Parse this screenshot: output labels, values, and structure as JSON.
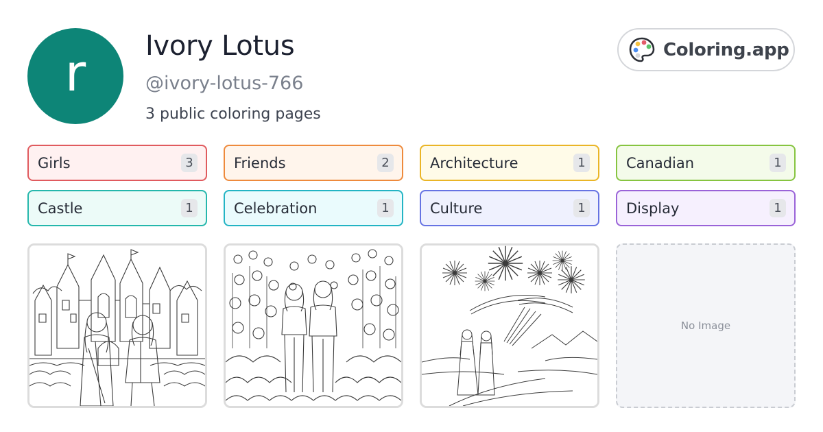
{
  "profile": {
    "avatar_letter": "r",
    "avatar_color": "#0d8577",
    "name": "Ivory Lotus",
    "handle": "@ivory-lotus-766",
    "page_count": "3 public coloring pages"
  },
  "brand": {
    "label": "Coloring.app",
    "icon": "palette-icon"
  },
  "tags": [
    {
      "label": "Girls",
      "count": "3",
      "border": "#e05a5e",
      "bg": "#fff1f1"
    },
    {
      "label": "Friends",
      "count": "2",
      "border": "#ee8a3c",
      "bg": "#fff5ec"
    },
    {
      "label": "Architecture",
      "count": "1",
      "border": "#eab526",
      "bg": "#fffbe8"
    },
    {
      "label": "Canadian",
      "count": "1",
      "border": "#86c440",
      "bg": "#f4fbea"
    },
    {
      "label": "Castle",
      "count": "1",
      "border": "#25b7ac",
      "bg": "#ecfbf8"
    },
    {
      "label": "Celebration",
      "count": "1",
      "border": "#23b4c4",
      "bg": "#eafbfd"
    },
    {
      "label": "Culture",
      "count": "1",
      "border": "#6673e3",
      "bg": "#eff1fe"
    },
    {
      "label": "Display",
      "count": "1",
      "border": "#9a63d8",
      "bg": "#f6f0fe"
    }
  ],
  "cards": [
    {
      "subject": "castle-girls-image"
    },
    {
      "subject": "garden-friends-image"
    },
    {
      "subject": "fireworks-girls-image"
    },
    {
      "placeholder": "No Image"
    }
  ]
}
